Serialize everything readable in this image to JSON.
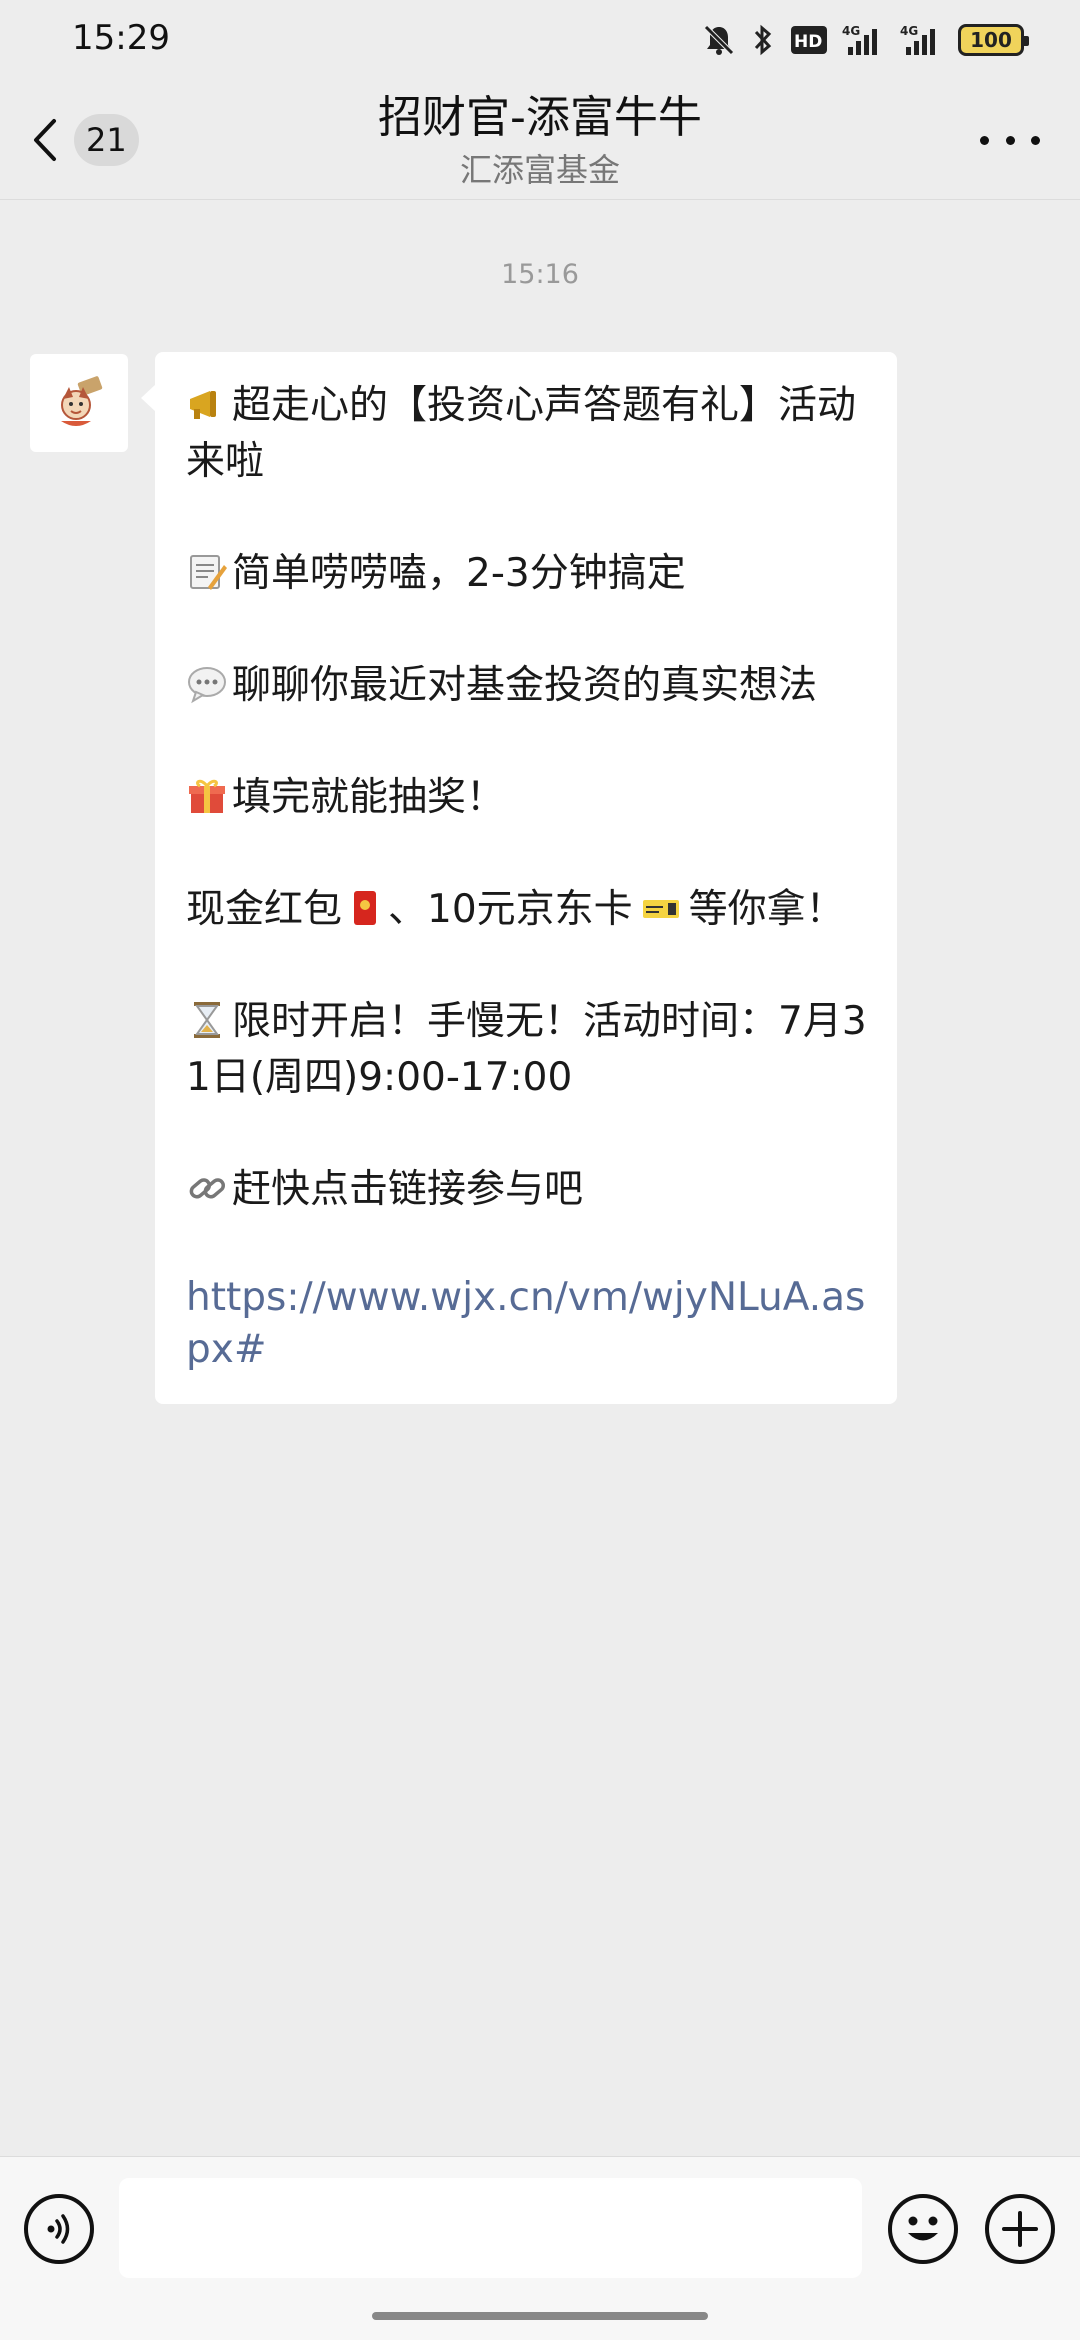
{
  "status_bar": {
    "time": "15:29",
    "icons": [
      "mute-bell-icon",
      "bluetooth-icon",
      "hd-voice-icon",
      "signal-4g-icon",
      "signal-4g-icon",
      "battery-icon"
    ],
    "hd_label": "HD",
    "network_label": "4G",
    "battery_level": "100"
  },
  "header": {
    "unread_count": "21",
    "title": "招财官-添富牛牛",
    "subtitle": "汇添富基金"
  },
  "chat": {
    "timestamp": "15:16",
    "message": {
      "line1": "超走心的【投资心声答题有礼】活动来啦",
      "line2": "简单唠唠嗑，2-3分钟搞定",
      "line3": "聊聊你最近对基金投资的真实想法",
      "line4": "填完就能抽奖！",
      "line5_a": "现金红包",
      "line5_b": "、10元京东卡",
      "line5_c": "等你拿！",
      "line6": "限时开启！手慢无！活动时间：7月31日(周四)9:00-17:00",
      "line7": "赶快点击链接参与吧",
      "link": "https://www.wjx.cn/vm/wjyNLuA.aspx#"
    }
  },
  "input_bar": {
    "placeholder": ""
  },
  "colors": {
    "background": "#ededed",
    "bubble": "#ffffff",
    "link": "#576b95",
    "battery": "#f0d35b"
  }
}
